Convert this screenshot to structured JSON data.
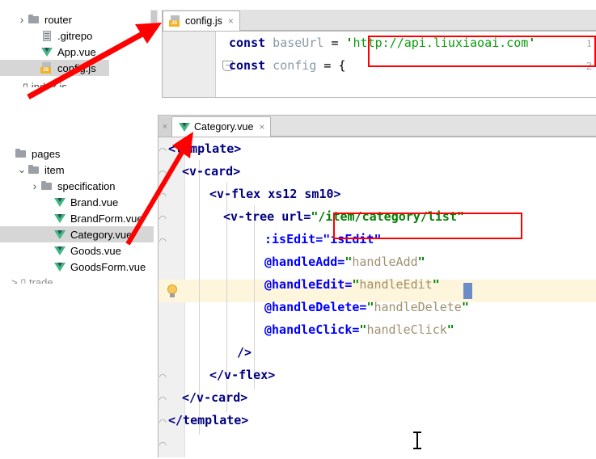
{
  "app": {
    "kind": "ide-screenshot",
    "colors": {
      "annotation_red": "#ff0000",
      "selection_gray": "#d6d6d6",
      "caret_line": "#fdf6dd",
      "tab_bar": "#e2e2e2",
      "gutter": "#ececec",
      "vue_green": "#41b883",
      "js_yellow": "#f0b429",
      "string_green": "#008000",
      "keyword_navy": "#000080",
      "attr_blue": "#0000ff",
      "attrval_tan": "#a09070"
    }
  },
  "top_tree": {
    "name": "project-file-tree-top",
    "items": [
      {
        "label": "router",
        "icon": "folder-icon",
        "indent": 1,
        "twisty": ">",
        "selected": false
      },
      {
        "label": ".gitrepo",
        "icon": "file-icon",
        "indent": 2,
        "twisty": "",
        "selected": false
      },
      {
        "label": "App.vue",
        "icon": "vue-icon",
        "indent": 2,
        "twisty": "",
        "selected": false
      },
      {
        "label": "config.js",
        "icon": "js-icon",
        "indent": 2,
        "twisty": "",
        "selected": true
      }
    ]
  },
  "bottom_tree": {
    "name": "project-file-tree-bottom",
    "items": [
      {
        "label": "pages",
        "icon": "folder-icon",
        "indent": 0,
        "twisty": "",
        "selected": false
      },
      {
        "label": "item",
        "icon": "folder-icon",
        "indent": 1,
        "twisty": "v",
        "selected": false
      },
      {
        "label": "specification",
        "icon": "folder-icon",
        "indent": 2,
        "twisty": ">",
        "selected": false
      },
      {
        "label": "Brand.vue",
        "icon": "vue-icon",
        "indent": 3,
        "twisty": "",
        "selected": false
      },
      {
        "label": "BrandForm.vue",
        "icon": "vue-icon",
        "indent": 3,
        "twisty": "",
        "selected": false
      },
      {
        "label": "Category.vue",
        "icon": "vue-icon",
        "indent": 3,
        "twisty": "",
        "selected": true
      },
      {
        "label": "Goods.vue",
        "icon": "vue-icon",
        "indent": 3,
        "twisty": "",
        "selected": false
      },
      {
        "label": "GoodsForm.vue",
        "icon": "vue-icon",
        "indent": 3,
        "twisty": "",
        "selected": false
      }
    ]
  },
  "top_editor": {
    "tab": {
      "label": "config.js",
      "icon": "js-icon",
      "close": "×"
    },
    "line_numbers": [
      "1",
      "2"
    ],
    "lines": [
      {
        "tokens": [
          {
            "text": "const",
            "cls": "kw"
          },
          {
            "text": " baseUrl ",
            "cls": "ident"
          },
          {
            "text": "= ",
            "cls": "op"
          },
          {
            "text": "'",
            "cls": "str"
          },
          {
            "text": "http://api.liuxiaoai.com",
            "cls": "strplain"
          },
          {
            "text": "'",
            "cls": "str"
          }
        ]
      },
      {
        "tokens": [
          {
            "text": "const",
            "cls": "kw"
          },
          {
            "text": " config ",
            "cls": "ident"
          },
          {
            "text": "= {",
            "cls": "op"
          }
        ]
      }
    ],
    "highlight_box_label": "base-url-annotation"
  },
  "bottom_editor": {
    "tab": {
      "label": "Category.vue",
      "icon": "vue-icon",
      "close": "×"
    },
    "ghost_tab_close": "×",
    "lines": [
      {
        "indent": 0,
        "tokens": [
          {
            "text": "<template>",
            "cls": "tag"
          }
        ]
      },
      {
        "indent": 1,
        "tokens": [
          {
            "text": "<v-card>",
            "cls": "tag"
          }
        ]
      },
      {
        "indent": 3,
        "tokens": [
          {
            "text": "<v-flex xs12 sm10>",
            "cls": "tag"
          }
        ]
      },
      {
        "indent": 4,
        "tokens": [
          {
            "text": "<v-tree url=",
            "cls": "tag"
          },
          {
            "text": "\"/item/category/list\"",
            "cls": "str"
          }
        ]
      },
      {
        "indent": 7,
        "tokens": [
          {
            "text": ":isEdit=",
            "cls": "attr"
          },
          {
            "text": "\"isEdit\"",
            "cls": "attr"
          }
        ]
      },
      {
        "indent": 7,
        "caret": true,
        "tokens": [
          {
            "text": "@handleAdd=",
            "cls": "attr"
          },
          {
            "text": "\"",
            "cls": "str"
          },
          {
            "text": "handleAdd",
            "cls": "attrval"
          },
          {
            "text": "\"",
            "cls": "str"
          }
        ]
      },
      {
        "indent": 7,
        "tokens": [
          {
            "text": "@handleEdit=",
            "cls": "attr"
          },
          {
            "text": "\"",
            "cls": "str"
          },
          {
            "text": "handleEdit",
            "cls": "attrval"
          },
          {
            "text": "\"",
            "cls": "str"
          }
        ]
      },
      {
        "indent": 7,
        "tokens": [
          {
            "text": "@handleDelete=",
            "cls": "attr"
          },
          {
            "text": "\"",
            "cls": "str"
          },
          {
            "text": "handleDelete",
            "cls": "attrval"
          },
          {
            "text": "\"",
            "cls": "str"
          }
        ]
      },
      {
        "indent": 7,
        "tokens": [
          {
            "text": "@handleClick=",
            "cls": "attr"
          },
          {
            "text": "\"",
            "cls": "str"
          },
          {
            "text": "handleClick",
            "cls": "attrval"
          },
          {
            "text": "\"",
            "cls": "str"
          }
        ]
      },
      {
        "indent": 5,
        "tokens": [
          {
            "text": "/>",
            "cls": "tag"
          }
        ]
      },
      {
        "indent": 3,
        "tokens": [
          {
            "text": "</v-flex>",
            "cls": "tag"
          }
        ]
      },
      {
        "indent": 1,
        "tokens": [
          {
            "text": "</v-card>",
            "cls": "tag"
          }
        ]
      },
      {
        "indent": 0,
        "tokens": [
          {
            "text": "</template>",
            "cls": "tag"
          }
        ]
      }
    ],
    "intention_bulb": "lightbulb-icon",
    "highlight_box_label": "tree-url-annotation"
  },
  "annotations": {
    "arrow_top": {
      "name": "arrow-to-config-tab",
      "color": "#ff0000"
    },
    "arrow_bottom": {
      "name": "arrow-to-category-tab",
      "color": "#ff0000"
    }
  },
  "mouse": {
    "cursor": "text-ibeam-cursor"
  }
}
